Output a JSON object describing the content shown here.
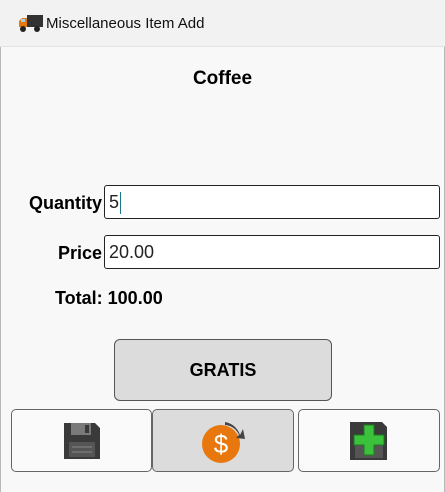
{
  "window": {
    "title": "Miscellaneous Item Add",
    "icon": "delivery-truck-icon"
  },
  "item": {
    "name": "Coffee"
  },
  "form": {
    "quantity_label": "Quantity",
    "quantity_value": "5",
    "price_label": "Price",
    "price_value": "20.00",
    "total_text": "Total: 100.00"
  },
  "buttons": {
    "gratis_label": "GRATIS",
    "save_icon": "floppy-disk-icon",
    "price_icon": "dollar-coin-icon",
    "add_icon": "add-plus-icon"
  },
  "colors": {
    "coin_orange": "#e8780e",
    "plus_green": "#3cc13c",
    "disk_dark": "#3a3a3a"
  }
}
